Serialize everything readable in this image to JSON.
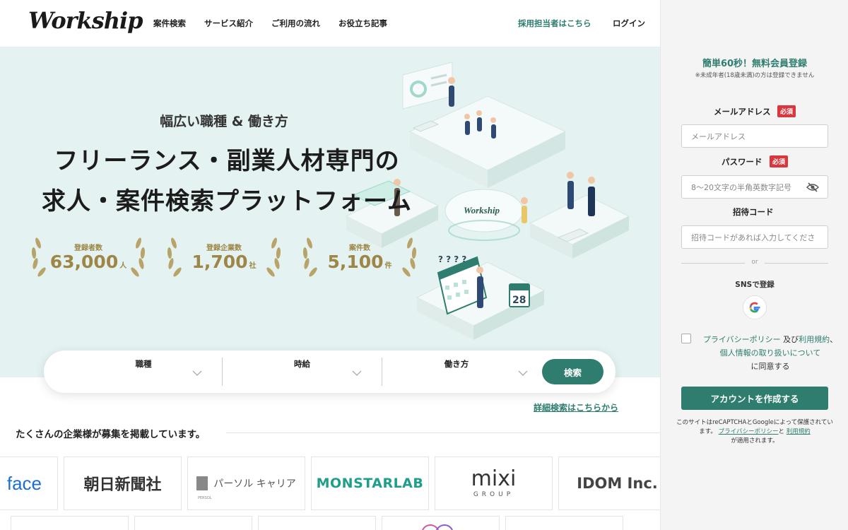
{
  "header": {
    "logo": "Workship",
    "nav": [
      "案件検索",
      "サービス紹介",
      "ご利用の流れ",
      "お役立ち記事"
    ],
    "recruiter_link": "採用担当者はこちら",
    "login": "ログイン"
  },
  "hero": {
    "subtitle": "幅広い職種 & 働き方",
    "title_line1": "フリーランス・副業人材専門の",
    "title_line2": "求人・案件検索プラットフォーム",
    "illustration_sign": "Workship",
    "calendar_day": "28",
    "stats": [
      {
        "label": "登録者数",
        "value": "63,000",
        "unit": "人"
      },
      {
        "label": "登録企業数",
        "value": "1,700",
        "unit": "社"
      },
      {
        "label": "案件数",
        "value": "5,100",
        "unit": "件"
      }
    ]
  },
  "search": {
    "fields": [
      "職種",
      "時給",
      "働き方"
    ],
    "button": "検索",
    "detail_link": "詳細検索はこちらから"
  },
  "companies": {
    "heading": "たくさんの企業様が募集を掲載しています。",
    "logos": [
      "face",
      "朝日新聞社",
      "パーソル キャリア",
      "MONSTARLAB",
      "mixi",
      "GROUP",
      "IDOM Inc."
    ],
    "persol_small": "PERSOL"
  },
  "signup": {
    "title": "簡単60秒！無料会員登録",
    "note": "※未成年者(18歳未満)の方は登録できません",
    "email_label": "メールアドレス",
    "email_placeholder": "メールアドレス",
    "required": "必須",
    "password_label": "パスワード",
    "password_placeholder": "8〜20文字の半角英数字記号",
    "invite_label": "招待コード",
    "invite_placeholder": "招待コードがあれば入力してくださ",
    "or": "or",
    "sns_label": "SNSで登録",
    "agree_privacy": "プライバシーポリシー",
    "agree_and": "及び",
    "agree_terms": "利用規約",
    "agree_comma": "、",
    "agree_personal": "個人情報の取り扱いについて",
    "agree_suffix": "に同意する",
    "create_button": "アカウントを作成する",
    "recaptcha_1": "このサイトはreCAPTCHAとGoogleによって保護されています。",
    "recaptcha_privacy": "プライバシーポリシー",
    "recaptcha_and": "と",
    "recaptcha_terms": "利用規約",
    "recaptcha_suffix": "が適用されます。"
  },
  "colors": {
    "brand": "#2e7d6e",
    "hero_bg": "#e4f3f1",
    "gold": "#9d8646",
    "required_badge": "#d9363e"
  }
}
